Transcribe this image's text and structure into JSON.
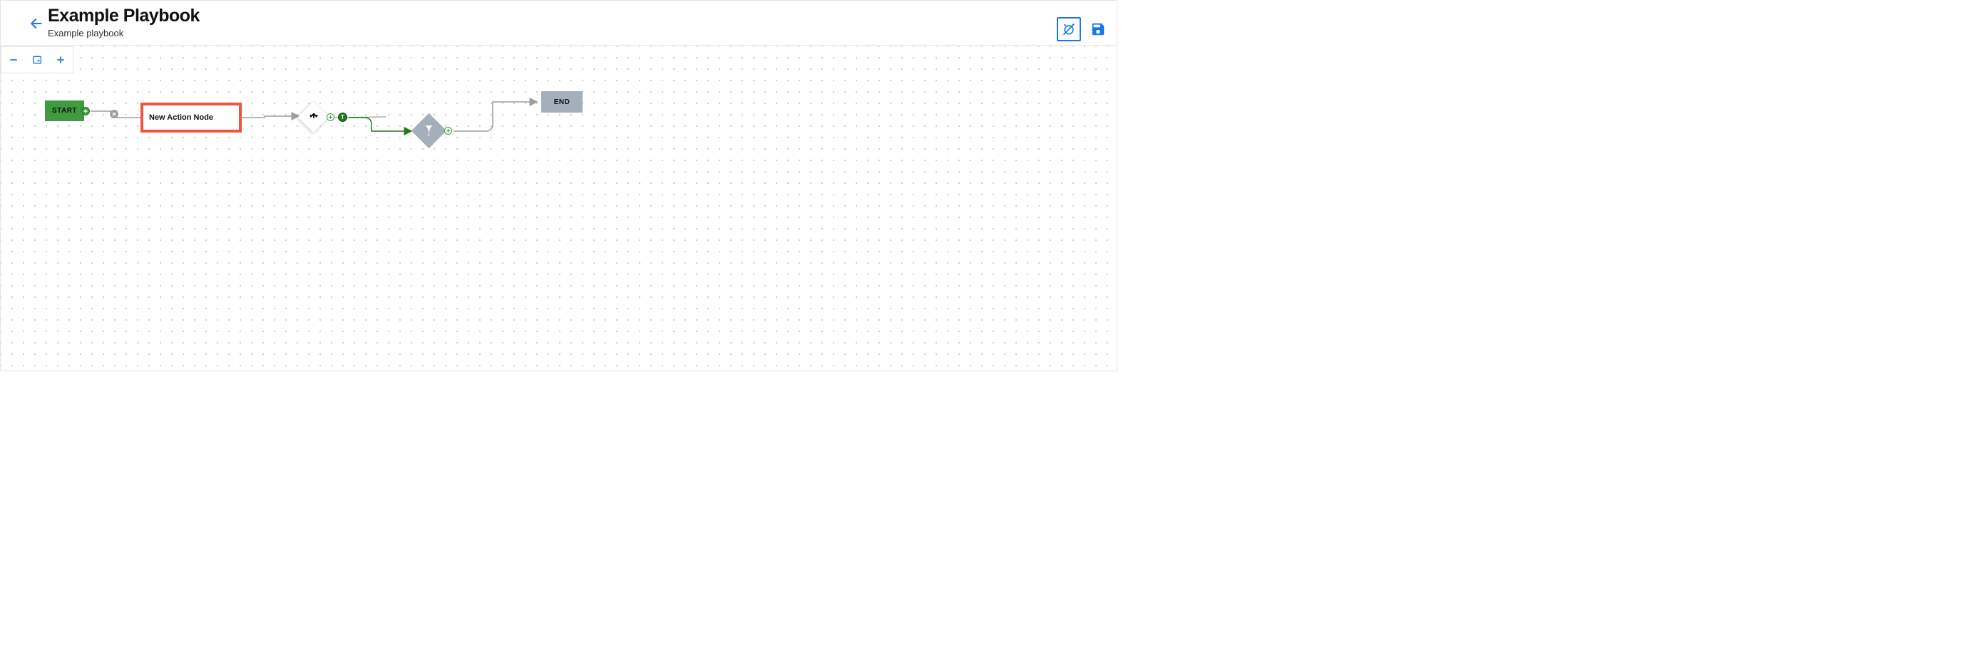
{
  "header": {
    "title": "Example Playbook",
    "subtitle": "Example playbook"
  },
  "nodes": {
    "start": {
      "label": "START"
    },
    "action": {
      "label": "New Action Node"
    },
    "branch": {
      "true_badge": "T"
    },
    "filter": {
      "badge": "1"
    },
    "end": {
      "label": "END"
    }
  },
  "colors": {
    "primary": "#1976F2",
    "start": "#3E9B3E",
    "action_border": "#F4543F",
    "neutral": "#A4AFBB",
    "edge_gray": "#9e9e9e",
    "edge_green": "#1d7a1d"
  }
}
